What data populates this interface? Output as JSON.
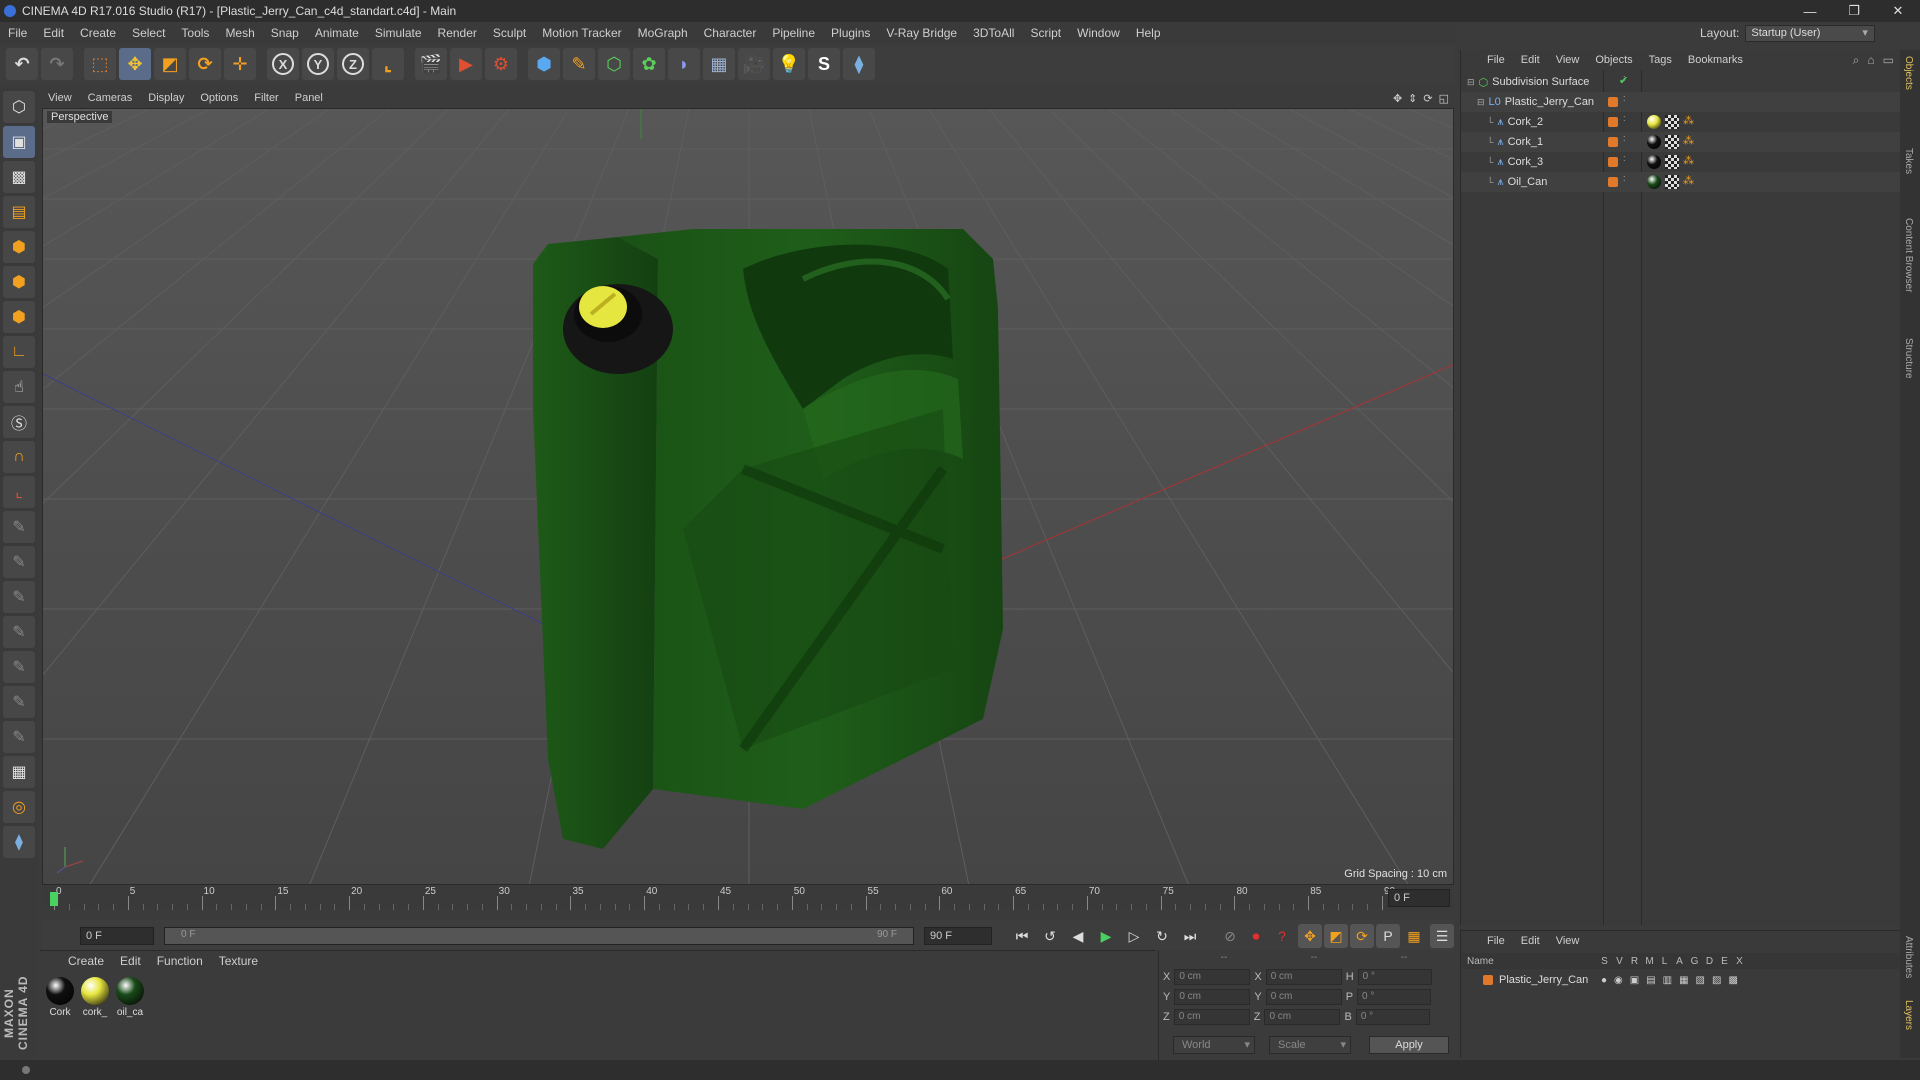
{
  "window": {
    "title": "CINEMA 4D R17.016 Studio (R17) - [Plastic_Jerry_Can_c4d_standart.c4d] - Main",
    "minimize": "—",
    "restore": "❐",
    "close": "✕"
  },
  "menu": [
    "File",
    "Edit",
    "Create",
    "Select",
    "Tools",
    "Mesh",
    "Snap",
    "Animate",
    "Simulate",
    "Render",
    "Sculpt",
    "Motion Tracker",
    "MoGraph",
    "Character",
    "Pipeline",
    "Plugins",
    "V-Ray Bridge",
    "3DToAll",
    "Script",
    "Window",
    "Help"
  ],
  "layout": {
    "label": "Layout:",
    "value": "Startup (User)"
  },
  "viewport": {
    "menu": [
      "View",
      "Cameras",
      "Display",
      "Options",
      "Filter",
      "Panel"
    ],
    "label": "Perspective",
    "grid_spacing": "Grid Spacing : 10 cm"
  },
  "timeline": {
    "ticks": [
      "0",
      "5",
      "10",
      "15",
      "20",
      "25",
      "30",
      "35",
      "40",
      "45",
      "50",
      "55",
      "60",
      "65",
      "70",
      "75",
      "80",
      "85",
      "90"
    ],
    "current_frame": "0 F",
    "start_field": "0 F",
    "range_start": "0 F",
    "range_end": "90 F",
    "end_field": "90 F"
  },
  "materials": {
    "menu": [
      "Create",
      "Edit",
      "Function",
      "Texture"
    ],
    "items": [
      {
        "name": "Cork",
        "color": "#101010"
      },
      {
        "name": "cork_",
        "color": "#e6e640"
      },
      {
        "name": "oil_ca",
        "color": "#1a4a1a"
      }
    ]
  },
  "coords": {
    "header": [
      "--",
      "--",
      "--"
    ],
    "rows": [
      {
        "a": "X",
        "av": "0 cm",
        "b": "X",
        "bv": "0 cm",
        "c": "H",
        "cv": "0 °"
      },
      {
        "a": "Y",
        "av": "0 cm",
        "b": "Y",
        "bv": "0 cm",
        "c": "P",
        "cv": "0 °"
      },
      {
        "a": "Z",
        "av": "0 cm",
        "b": "Z",
        "bv": "0 cm",
        "c": "B",
        "cv": "0 °"
      }
    ],
    "world": "World",
    "scale": "Scale",
    "apply": "Apply"
  },
  "objects": {
    "menu": [
      "File",
      "Edit",
      "View",
      "Objects",
      "Tags",
      "Bookmarks"
    ],
    "items": [
      {
        "name": "Subdivision Surface",
        "level": 0
      },
      {
        "name": "Plastic_Jerry_Can",
        "level": 1
      },
      {
        "name": "Cork_2",
        "level": 2,
        "tag": "#e6e640"
      },
      {
        "name": "Cork_1",
        "level": 2,
        "tag": "#101010"
      },
      {
        "name": "Cork_3",
        "level": 2,
        "tag": "#101010"
      },
      {
        "name": "Oil_Can",
        "level": 2,
        "tag": "#1a4a1a"
      }
    ]
  },
  "layers": {
    "menu": [
      "File",
      "Edit",
      "View"
    ],
    "columns": [
      "Name",
      "S",
      "V",
      "R",
      "M",
      "L",
      "A",
      "G",
      "D",
      "E",
      "X"
    ],
    "row": "Plastic_Jerry_Can"
  },
  "right_tabs": [
    "Objects",
    "Takes",
    "Content Browser",
    "Structure",
    "Attributes",
    "Layers"
  ],
  "maxon": "MAXON CINEMA 4D",
  "colors": {
    "accent": "#5a6c8a",
    "object_chip": "#e07a2a",
    "can_green": "#1f5a1a",
    "cap_yellow": "#e6e640"
  }
}
